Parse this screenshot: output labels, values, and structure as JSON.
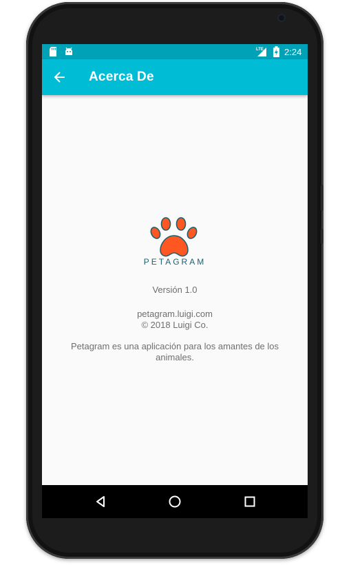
{
  "status_bar": {
    "time": "2:24",
    "network": "LTE",
    "icons": [
      "sd-card-icon",
      "android-icon",
      "signal-icon",
      "battery-charging-icon"
    ]
  },
  "app_bar": {
    "title": "Acerca De",
    "back_icon": "arrow-left-icon"
  },
  "about": {
    "logo_text": "PETAGRAM",
    "version": "Versión 1.0",
    "website": "petagram.luigi.com",
    "copyright": "© 2018 Luigi Co.",
    "description_line1": "Petagram es una aplicación para los amantes de los",
    "description_line2": "animales."
  },
  "colors": {
    "status_bar": "#00a2b8",
    "app_bar": "#00bcd4",
    "paw": "#ff5722",
    "paw_outline": "#1f6070",
    "background": "#fafafa"
  },
  "nav_bar": {
    "buttons": [
      "back-triangle-icon",
      "home-circle-icon",
      "recents-square-icon"
    ]
  }
}
